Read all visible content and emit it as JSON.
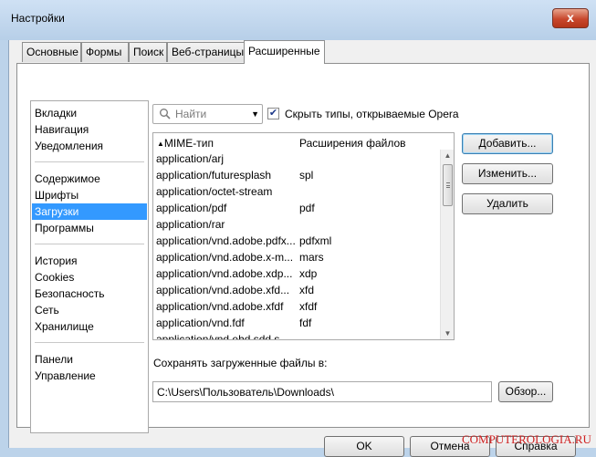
{
  "window": {
    "title": "Настройки",
    "close_glyph": "x"
  },
  "tabs": [
    "Основные",
    "Формы",
    "Поиск",
    "Веб-страницы",
    "Расширенные"
  ],
  "sidebar": {
    "groups": [
      [
        "Вкладки",
        "Навигация",
        "Уведомления"
      ],
      [
        "Содержимое",
        "Шрифты",
        "Загрузки",
        "Программы"
      ],
      [
        "История",
        "Cookies",
        "Безопасность",
        "Сеть",
        "Хранилище"
      ],
      [
        "Панели",
        "Управление"
      ]
    ],
    "selected": "Загрузки"
  },
  "search": {
    "placeholder": "Найти",
    "icon": "search-icon"
  },
  "hide_types": {
    "checked": true,
    "label": "Скрыть типы, открываемые Opera"
  },
  "table": {
    "col_type": "MIME-тип",
    "col_ext": "Расширения файлов",
    "rows": [
      [
        "application/arj",
        ""
      ],
      [
        "application/futuresplash",
        "spl"
      ],
      [
        "application/octet-stream",
        ""
      ],
      [
        "application/pdf",
        "pdf"
      ],
      [
        "application/rar",
        ""
      ],
      [
        "application/vnd.adobe.pdfx...",
        "pdfxml"
      ],
      [
        "application/vnd.adobe.x-m...",
        "mars"
      ],
      [
        "application/vnd.adobe.xdp...",
        "xdp"
      ],
      [
        "application/vnd.adobe.xfd...",
        "xfd"
      ],
      [
        "application/vnd.adobe.xfdf",
        "xfdf"
      ],
      [
        "application/vnd.fdf",
        "fdf"
      ],
      [
        "application/vnd.ehd.sdd.s",
        "..."
      ]
    ]
  },
  "buttons": {
    "add": "Добавить...",
    "edit": "Изменить...",
    "delete": "Удалить",
    "browse": "Обзор..."
  },
  "save": {
    "label": "Сохранять загруженные файлы в:",
    "path": "C:\\Users\\Пользователь\\Downloads\\"
  },
  "footer": {
    "ok": "OK",
    "cancel": "Отмена",
    "help": "Справка"
  },
  "watermark": "COMPUTEROLOGIA.RU"
}
